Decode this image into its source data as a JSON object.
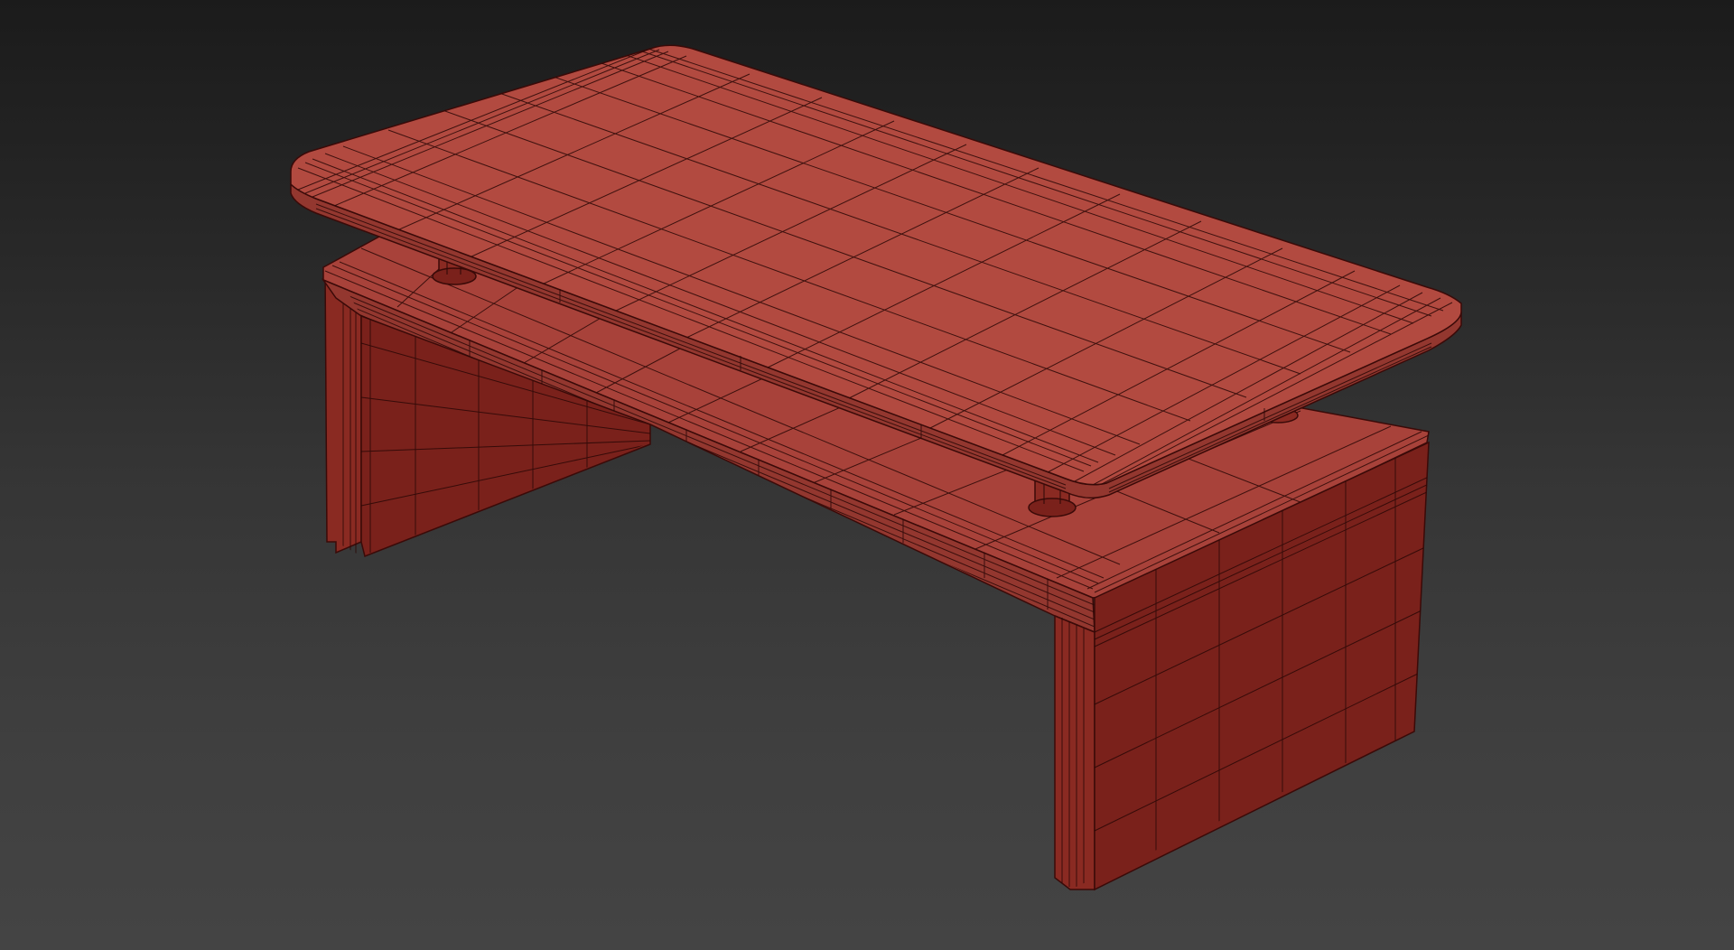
{
  "scene": {
    "viewport_background_top": "#1b1b1b",
    "viewport_background_bottom": "#444444",
    "model_colors": {
      "top_face": "#b24a40",
      "front_face": "#9a3a31",
      "side_face": "#7a211b",
      "edge": "#3a0a08",
      "wire": "#2a0806"
    },
    "objects": [
      "table-top",
      "table-base",
      "left-leg-panel",
      "right-leg-panel",
      "support-post-left",
      "support-post-right",
      "support-post-back"
    ]
  }
}
